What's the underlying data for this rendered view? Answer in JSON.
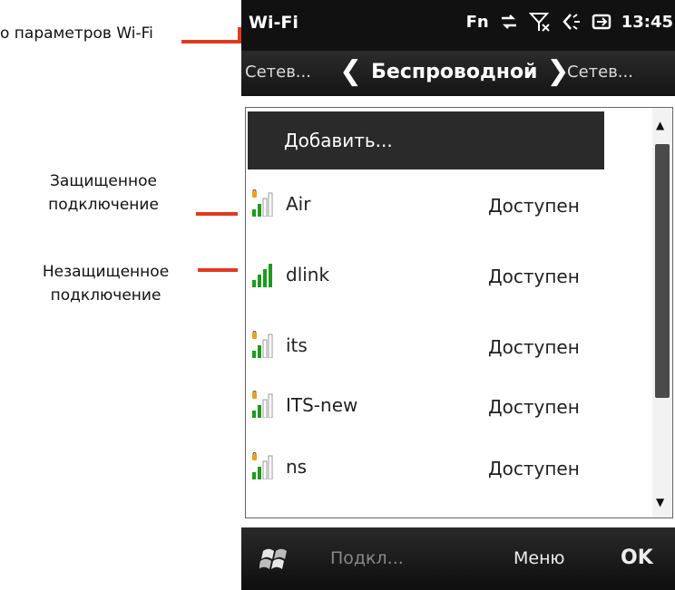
{
  "annotations": {
    "top": "о параметров Wi-Fi",
    "secure_line1": "Защищенное",
    "secure_line2": "подключение",
    "open_line1": "Незащищенное",
    "open_line2": "подключение"
  },
  "status_bar": {
    "title": "Wi-Fi",
    "fn": "Fn",
    "time": "13:45",
    "icons": [
      "data-sync-icon",
      "no-signal-icon",
      "volume-icon",
      "battery-charging-icon"
    ]
  },
  "nav": {
    "prev": "Сетев...",
    "current": "Беспроводной",
    "next": "Сетев..."
  },
  "list": {
    "add_label": "Добавить...",
    "networks": [
      {
        "name": "Air",
        "status": "Доступен",
        "secure": true
      },
      {
        "name": "dlink",
        "status": "Доступен",
        "secure": false
      },
      {
        "name": "its",
        "status": "Доступен",
        "secure": true
      },
      {
        "name": "ITS-new",
        "status": "Доступен",
        "secure": true
      },
      {
        "name": "ns",
        "status": "Доступен",
        "secure": true
      }
    ]
  },
  "softkeys": {
    "left": "Подкл...",
    "menu": "Меню",
    "ok": "OK"
  },
  "colors": {
    "pointer": "#e03a1e",
    "signal": "#1e9a1e",
    "lock": "#e8a21c"
  }
}
